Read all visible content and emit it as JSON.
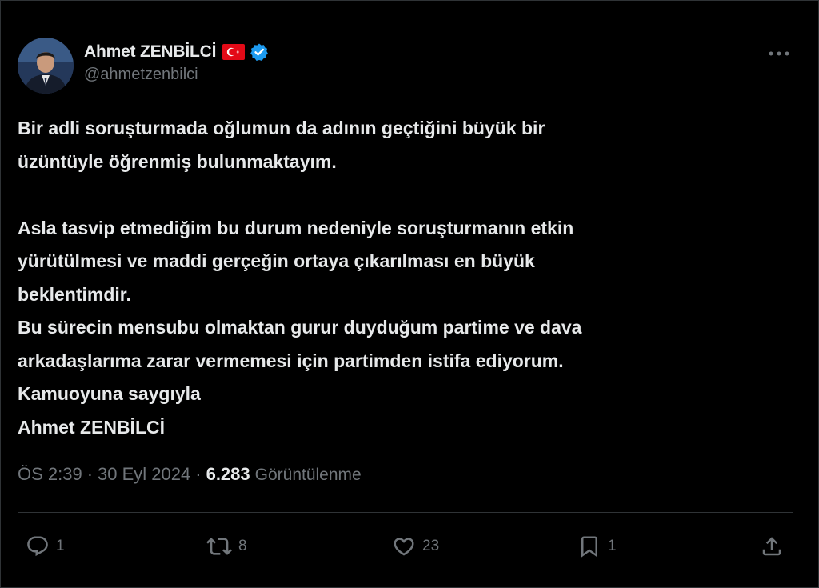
{
  "author": {
    "display_name": "Ahmet ZENBİLCİ",
    "handle": "@ahmetzenbilci",
    "flag_icon": "turkey-flag-icon",
    "verified_icon": "verified-badge-icon",
    "verified_color": "#1d9bf0"
  },
  "tweet": {
    "lines": [
      "Bir adli soruşturmada oğlumun da adının geçtiğini büyük bir",
      "üzüntüyle öğrenmiş bulunmaktayım.",
      "",
      "Asla tasvip etmediğim bu durum nedeniyle soruşturmanın etkin",
      "yürütülmesi ve maddi gerçeğin ortaya çıkarılması en büyük",
      "beklentimdir.",
      "Bu sürecin mensubu olmaktan gurur duyduğum partime ve dava",
      "arkadaşlarıma zarar vermemesi için partimden istifa ediyorum.",
      "Kamuoyuna saygıyla",
      "Ahmet ZENBİLCİ"
    ]
  },
  "meta": {
    "time": "ÖS 2:39",
    "separator": "·",
    "date": "30 Eyl 2024",
    "views_count": "6.283",
    "views_label": "Görüntülenme"
  },
  "actions": {
    "reply_count": "1",
    "repost_count": "8",
    "like_count": "23",
    "bookmark_count": "1"
  },
  "colors": {
    "background": "#000000",
    "text": "#e7e9ea",
    "secondary": "#71767b",
    "border": "#2f3336",
    "accent": "#1d9bf0"
  }
}
